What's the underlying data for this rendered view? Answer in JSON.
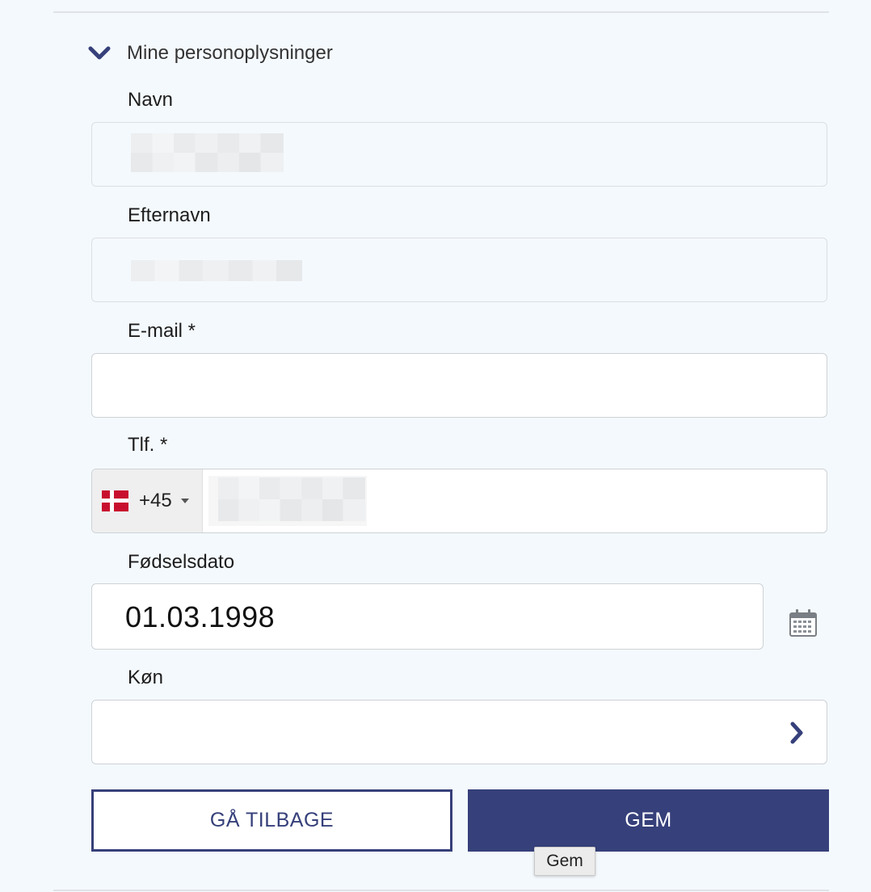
{
  "section": {
    "title": "Mine personoplysninger",
    "icon": "chevron-down-icon",
    "accent": "#36407a"
  },
  "fields": {
    "first_name": {
      "label": "Navn"
    },
    "last_name": {
      "label": "Efternavn"
    },
    "email": {
      "label": "E-mail *",
      "value": ""
    },
    "phone": {
      "label": "Tlf. *",
      "country_flag": "denmark-flag-icon",
      "dial_code": "+45"
    },
    "birthdate": {
      "label": "Fødselsdato",
      "value": "01.03.1998",
      "icon": "calendar-icon"
    },
    "gender": {
      "label": "Køn",
      "value": "",
      "icon": "chevron-right-icon"
    }
  },
  "buttons": {
    "back_label": "GÅ TILBAGE",
    "save_label": "GEM"
  },
  "tooltip": {
    "text": "Gem"
  },
  "colors": {
    "primary": "#36407a",
    "background": "#f4f9fd",
    "flag_red": "#c8102e"
  }
}
